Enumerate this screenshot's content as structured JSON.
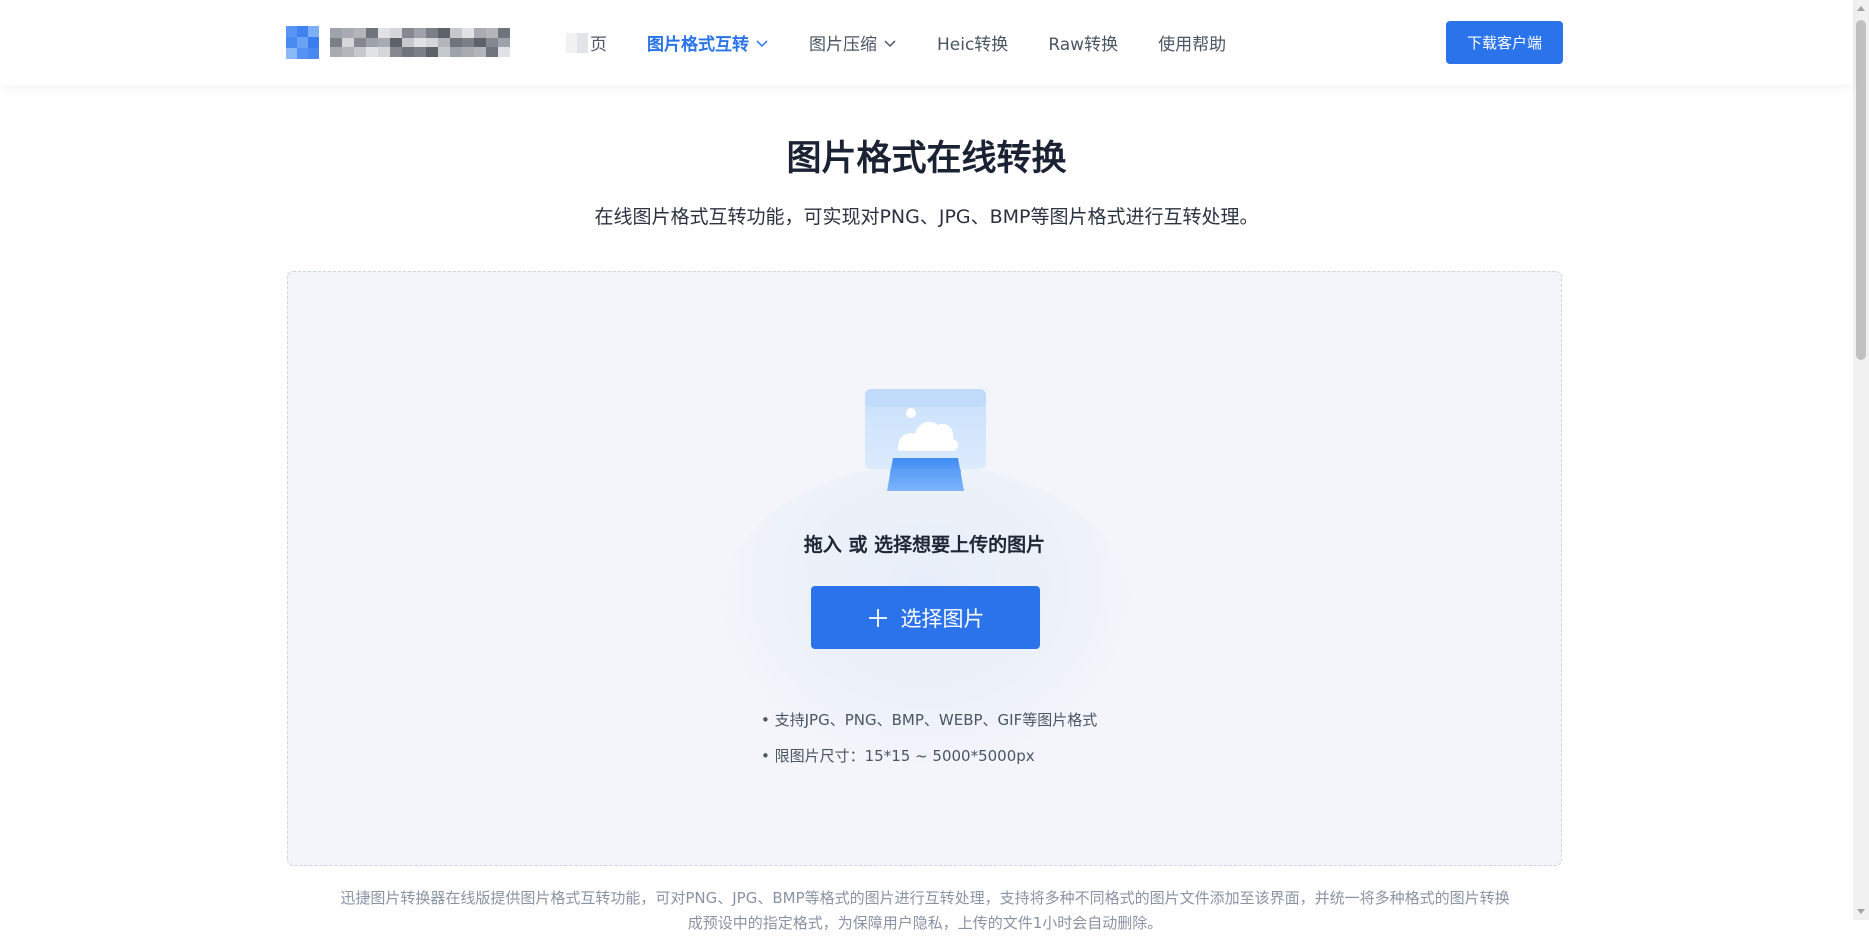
{
  "header": {
    "nav": {
      "home_label": "页",
      "format_convert_label": "图片格式互转",
      "compress_label": "图片压缩",
      "heic_label": "Heic转换",
      "raw_label": "Raw转换",
      "help_label": "使用帮助"
    },
    "download_label": "下载客户端"
  },
  "main": {
    "title": "图片格式在线转换",
    "subtitle": "在线图片格式互转功能，可实现对PNG、JPG、BMP等图片格式进行互转处理。"
  },
  "upload": {
    "prompt": "拖入 或 选择想要上传的图片",
    "select_label": "选择图片",
    "tips": [
      "支持JPG、PNG、BMP、WEBP、GIF等图片格式",
      "限图片尺寸：15*15 ~ 5000*5000px"
    ]
  },
  "footer": {
    "description": "迅捷图片转换器在线版提供图片格式互转功能，可对PNG、JPG、BMP等格式的图片进行互转处理，支持将多种不同格式的图片文件添加至该界面，并统一将多种格式的图片转换成预设中的指定格式，为保障用户隐私，上传的文件1小时会自动删除。"
  },
  "colors": {
    "accent": "#2a73ea",
    "upload_bg": "#f3f5fa",
    "text_dark": "#1b2233",
    "text_muted": "#8a93a3"
  },
  "icons": {
    "logo": "logo-mark-icon",
    "dropdown": "chevron-down-icon",
    "upload": "image-upload-icon",
    "add": "plus-icon"
  }
}
